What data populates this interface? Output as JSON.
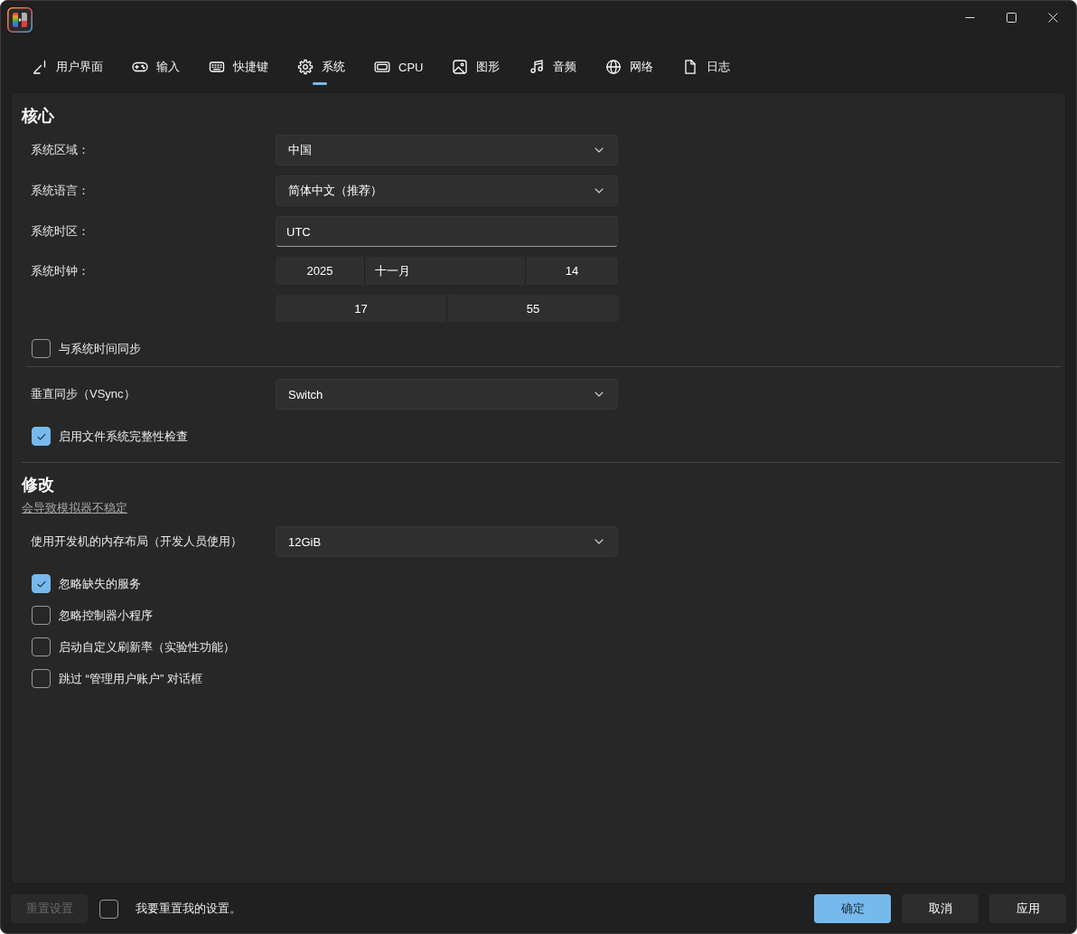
{
  "tabs": [
    {
      "kind": "ui",
      "label": "用户界面",
      "selected": false
    },
    {
      "kind": "input",
      "label": "输入",
      "selected": false
    },
    {
      "kind": "hotkeys",
      "label": "快捷键",
      "selected": false
    },
    {
      "kind": "system",
      "label": "系统",
      "selected": true
    },
    {
      "kind": "cpu",
      "label": "CPU",
      "selected": false
    },
    {
      "kind": "graphics",
      "label": "图形",
      "selected": false
    },
    {
      "kind": "audio",
      "label": "音频",
      "selected": false
    },
    {
      "kind": "network",
      "label": "网络",
      "selected": false
    },
    {
      "kind": "logs",
      "label": "日志",
      "selected": false
    }
  ],
  "sections": [
    {
      "title": "核心",
      "items": [
        {
          "kind": "dropdown",
          "label": "系统区域：",
          "value": "中国"
        },
        {
          "kind": "dropdown",
          "label": "系统语言：",
          "value": "简体中文（推荐）"
        },
        {
          "kind": "text",
          "label": "系统时区：",
          "value": "UTC"
        },
        {
          "kind": "date",
          "label": "系统时钟：",
          "parts": [
            "2025",
            "十一月",
            "14"
          ]
        },
        {
          "kind": "time",
          "parts": [
            "17",
            "55"
          ]
        },
        {
          "kind": "checkbox",
          "label": "与系统时间同步",
          "checked": false
        },
        {
          "kind": "divider"
        },
        {
          "kind": "dropdown",
          "label": "垂直同步（VSync）",
          "value": "Switch"
        },
        {
          "kind": "checkbox",
          "label": "启用文件系统完整性检查",
          "checked": true
        }
      ]
    },
    {
      "title": "修改",
      "subtitle": "会导致模拟器不稳定",
      "items": [
        {
          "kind": "dropdown",
          "label": "使用开发机的内存布局（开发人员使用）",
          "value": "12GiB"
        },
        {
          "kind": "checkbox",
          "label": "忽略缺失的服务",
          "checked": true
        },
        {
          "kind": "checkbox",
          "label": "忽略控制器小程序",
          "checked": false
        },
        {
          "kind": "checkbox",
          "label": "启动自定义刷新率（实验性功能）",
          "checked": false
        },
        {
          "kind": "checkbox",
          "label": "跳过 “管理用户账户” 对话框",
          "checked": false
        }
      ]
    }
  ],
  "footer": {
    "reset_button": {
      "label": "重置设置",
      "disabled": true
    },
    "reset_confirm": {
      "label": "我要重置我的设置。",
      "checked": false
    },
    "buttons": [
      {
        "kind": "confirm",
        "label": "确定"
      },
      {
        "kind": "cancel",
        "label": "取消"
      },
      {
        "kind": "apply",
        "label": "应用"
      }
    ]
  }
}
